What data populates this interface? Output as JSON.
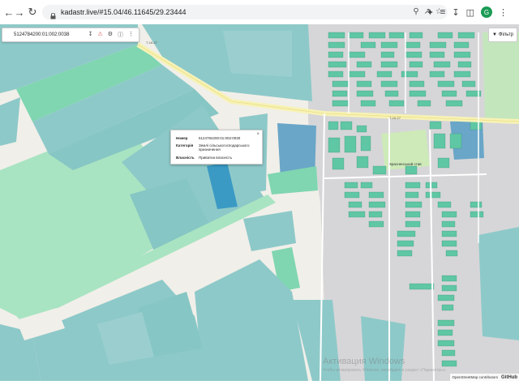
{
  "browser": {
    "url": "kadastr.live/#15.04/46.11645/29.23444",
    "avatar_letter": "G"
  },
  "search": {
    "value": "5124784200:01:002:0038"
  },
  "filter": {
    "label": "Фільтр"
  },
  "popup": {
    "rows": [
      {
        "key": "Номер",
        "value": "5124784200:01:002:0030"
      },
      {
        "key": "Категорія",
        "value": "Землі сільськогосподарського призначення"
      },
      {
        "key": "Власність",
        "value": "Приватна власність"
      }
    ]
  },
  "map": {
    "place_label": "Красненський став",
    "road_labels": [
      "Т-16-27",
      "Т-16-27"
    ]
  },
  "attribution": {
    "text": "OpenStreetMap contributors",
    "github": "GitHub"
  },
  "watermark": {
    "title": "Активация Windows",
    "subtitle": "Чтобы активировать Windows, перейдите в раздел «Параметры»."
  },
  "colors": {
    "parcel": "#8ec9c9",
    "parcel_green": "#7fd6b0",
    "field_green": "#a9e4c2",
    "selected": "#3a9ac4",
    "background": "#f1efe9",
    "village": "#d6d6d8"
  }
}
